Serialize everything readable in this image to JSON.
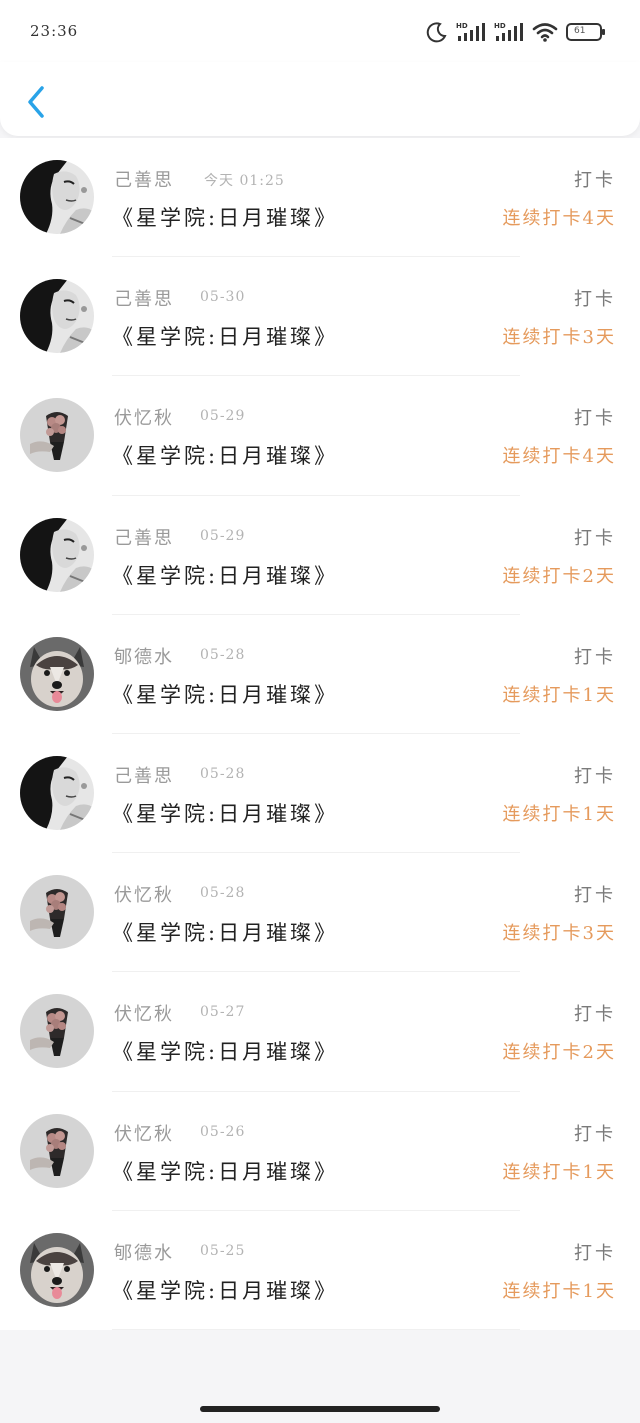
{
  "status": {
    "time": "23:36",
    "battery": "61"
  },
  "colors": {
    "accent": "#29a3e8",
    "streak": "#e59a5c"
  },
  "rows": [
    {
      "name": "己善思",
      "date": "今天 01:25",
      "book": "《星学院:日月璀璨》",
      "tag": "打卡",
      "streak": "连续打卡4天",
      "avatar": "girl-portrait"
    },
    {
      "name": "己善思",
      "date": "05-30",
      "book": "《星学院:日月璀璨》",
      "tag": "打卡",
      "streak": "连续打卡3天",
      "avatar": "girl-portrait"
    },
    {
      "name": "伏忆秋",
      "date": "05-29",
      "book": "《星学院:日月璀璨》",
      "tag": "打卡",
      "streak": "连续打卡4天",
      "avatar": "flower-bouquet"
    },
    {
      "name": "己善思",
      "date": "05-29",
      "book": "《星学院:日月璀璨》",
      "tag": "打卡",
      "streak": "连续打卡2天",
      "avatar": "girl-portrait"
    },
    {
      "name": "郇德水",
      "date": "05-28",
      "book": "《星学院:日月璀璨》",
      "tag": "打卡",
      "streak": "连续打卡1天",
      "avatar": "husky-dog"
    },
    {
      "name": "己善思",
      "date": "05-28",
      "book": "《星学院:日月璀璨》",
      "tag": "打卡",
      "streak": "连续打卡1天",
      "avatar": "girl-portrait"
    },
    {
      "name": "伏忆秋",
      "date": "05-28",
      "book": "《星学院:日月璀璨》",
      "tag": "打卡",
      "streak": "连续打卡3天",
      "avatar": "flower-bouquet"
    },
    {
      "name": "伏忆秋",
      "date": "05-27",
      "book": "《星学院:日月璀璨》",
      "tag": "打卡",
      "streak": "连续打卡2天",
      "avatar": "flower-bouquet"
    },
    {
      "name": "伏忆秋",
      "date": "05-26",
      "book": "《星学院:日月璀璨》",
      "tag": "打卡",
      "streak": "连续打卡1天",
      "avatar": "flower-bouquet"
    },
    {
      "name": "郇德水",
      "date": "05-25",
      "book": "《星学院:日月璀璨》",
      "tag": "打卡",
      "streak": "连续打卡1天",
      "avatar": "husky-dog"
    }
  ]
}
